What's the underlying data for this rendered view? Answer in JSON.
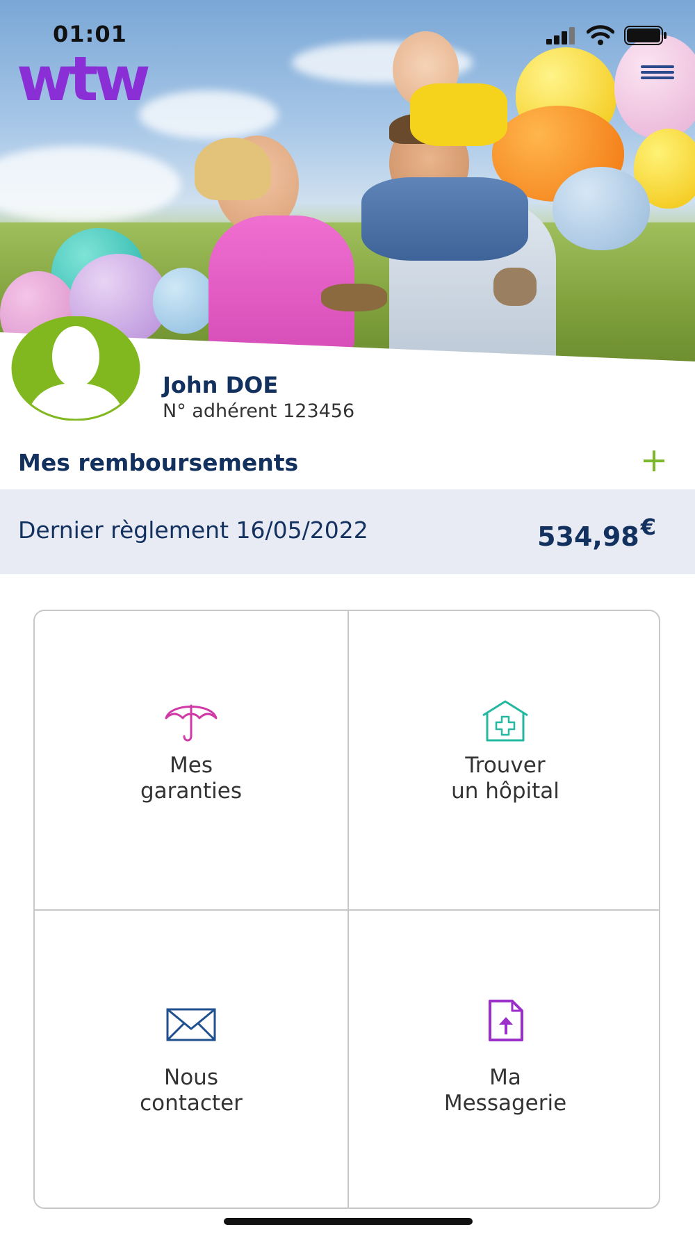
{
  "status_bar": {
    "time": "01:01"
  },
  "header": {
    "logo_text": "wtw",
    "logo_color": "#8a2fd6",
    "menu_icon": "hamburger-menu-icon"
  },
  "user": {
    "name": "John DOE",
    "member_number": "N° adhérent 123456"
  },
  "reimbursements": {
    "title": "Mes remboursements",
    "expand_icon": "plus-icon",
    "last_payment_label": "Dernier règlement 16/05/2022",
    "last_payment_amount": "534,98",
    "currency": "€"
  },
  "tiles": [
    {
      "label_line1": "Mes",
      "label_line2": "garanties",
      "icon": "umbrella-icon",
      "icon_color": "#d13aa6"
    },
    {
      "label_line1": "Trouver",
      "label_line2": "un hôpital",
      "icon": "hospital-icon",
      "icon_color": "#25b8a0"
    },
    {
      "label_line1": "Nous",
      "label_line2": "contacter",
      "icon": "envelope-icon",
      "icon_color": "#1e4f8f"
    },
    {
      "label_line1": "Ma",
      "label_line2": "Messagerie",
      "icon": "document-upload-icon",
      "icon_color": "#9b2fc9"
    }
  ],
  "colors": {
    "navy": "#12315f",
    "accent_green": "#7bb82a",
    "banner_bg": "#e8eaf4"
  }
}
